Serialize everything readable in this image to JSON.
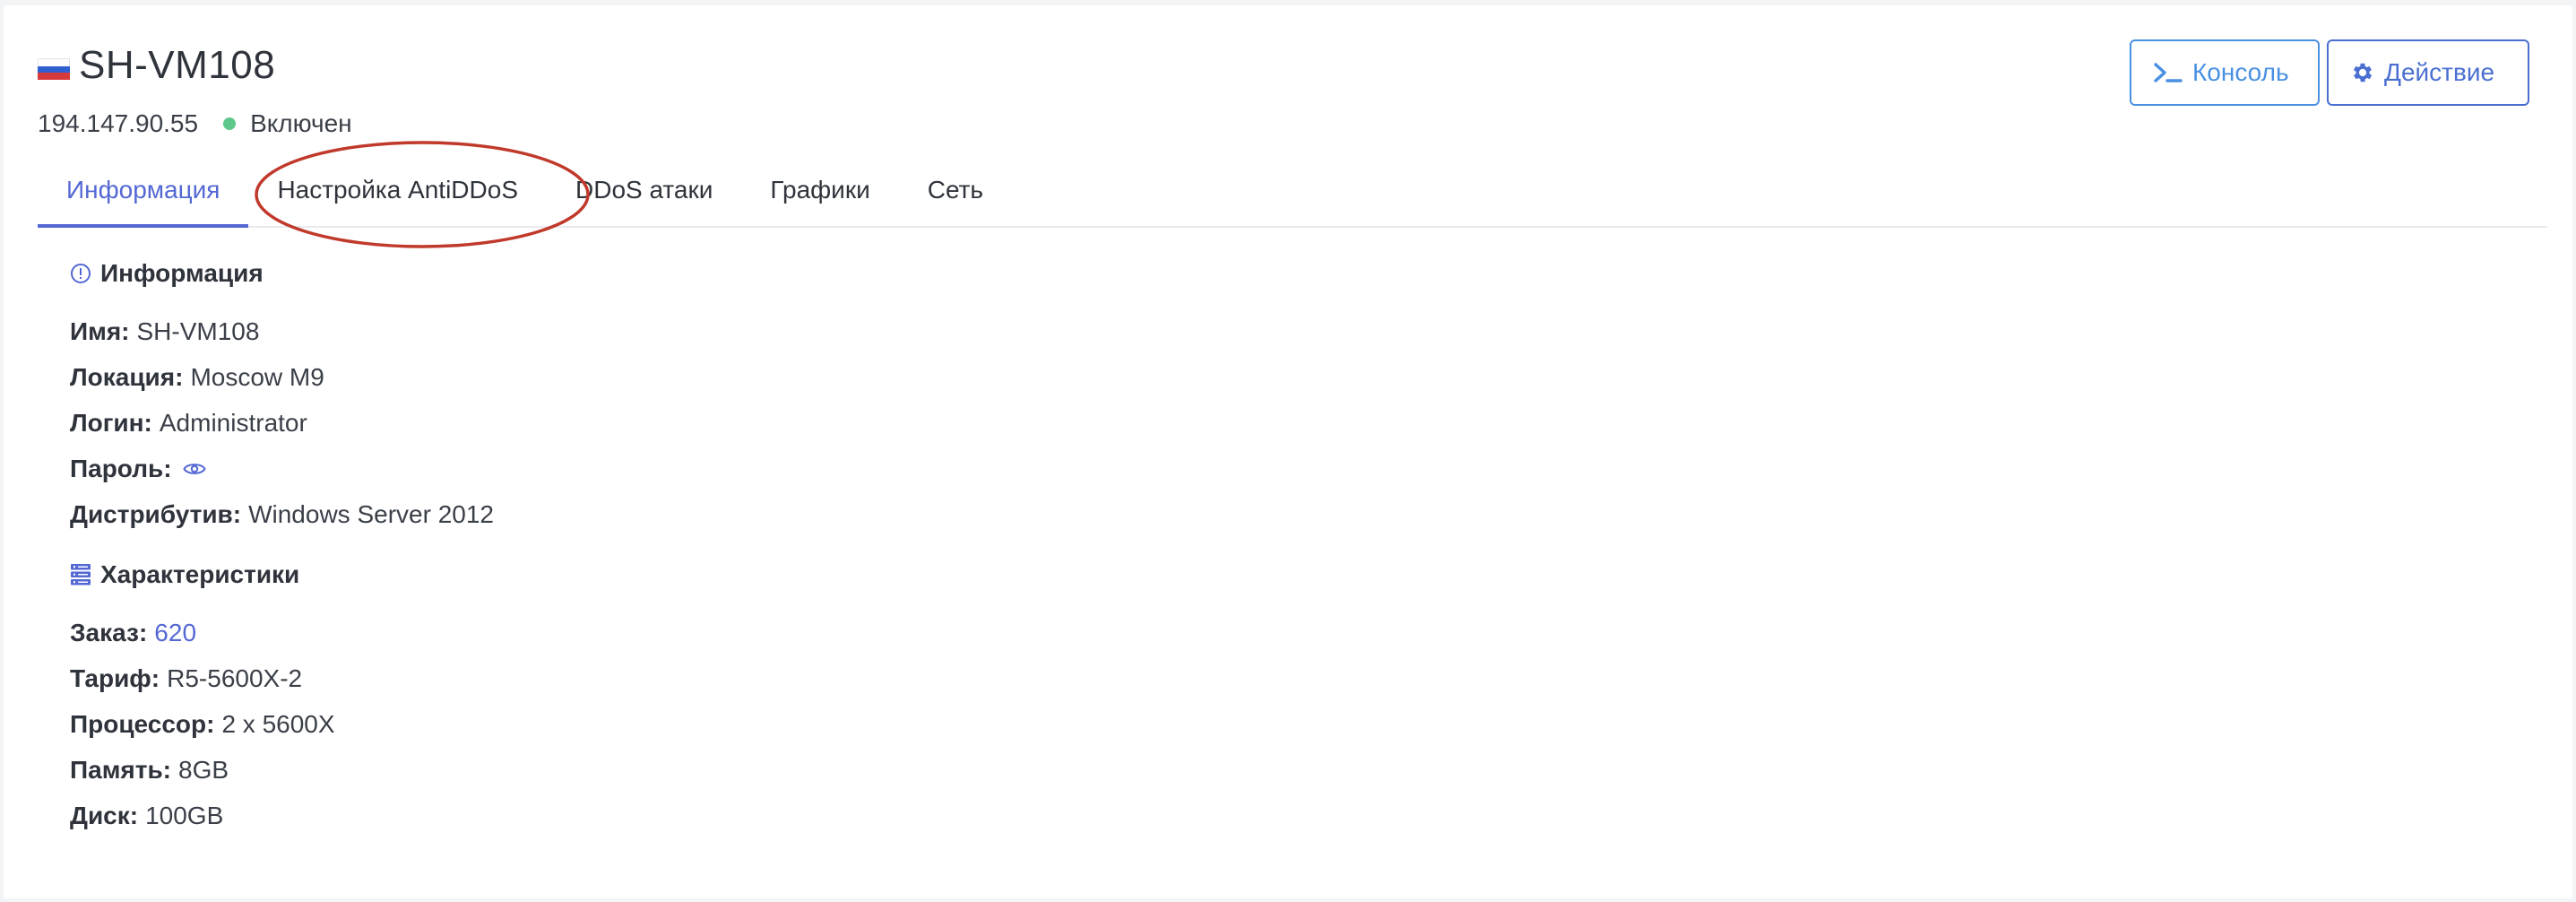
{
  "vm": {
    "name": "SH-VM108",
    "ip": "194.147.90.55",
    "status": "Включен",
    "status_color": "#5cc98a",
    "flag_icon": "russia-flag-icon"
  },
  "actions": {
    "console_label": "Консоль",
    "console_icon": "terminal-icon",
    "action_label": "Действие",
    "action_icon": "gear-icon"
  },
  "tabs": [
    {
      "label": "Информация",
      "active": true
    },
    {
      "label": "Настройка AntiDDoS",
      "active": false
    },
    {
      "label": "DDoS атаки",
      "active": false
    },
    {
      "label": "Графики",
      "active": false
    },
    {
      "label": "Сеть",
      "active": false
    }
  ],
  "info": {
    "title": "Информация",
    "icon": "info-circle-icon",
    "name_label": "Имя:",
    "name_value": "SH-VM108",
    "location_label": "Локация:",
    "location_value": "Moscow M9",
    "login_label": "Логин:",
    "login_value": "Administrator",
    "password_label": "Пароль:",
    "password_icon": "eye-icon",
    "distro_label": "Дистрибутив:",
    "distro_value": "Windows Server 2012"
  },
  "specs": {
    "title": "Характеристики",
    "icon": "server-icon",
    "order_label": "Заказ:",
    "order_value": "620",
    "tariff_label": "Тариф:",
    "tariff_value": "R5-5600X-2",
    "cpu_label": "Процессор:",
    "cpu_value": "2 x 5600X",
    "memory_label": "Память:",
    "memory_value": "8GB",
    "disk_label": "Диск:",
    "disk_value": "100GB"
  },
  "colors": {
    "accent": "#5468d4",
    "console_button": "#4a90e2",
    "annotation": "#c0392b"
  }
}
